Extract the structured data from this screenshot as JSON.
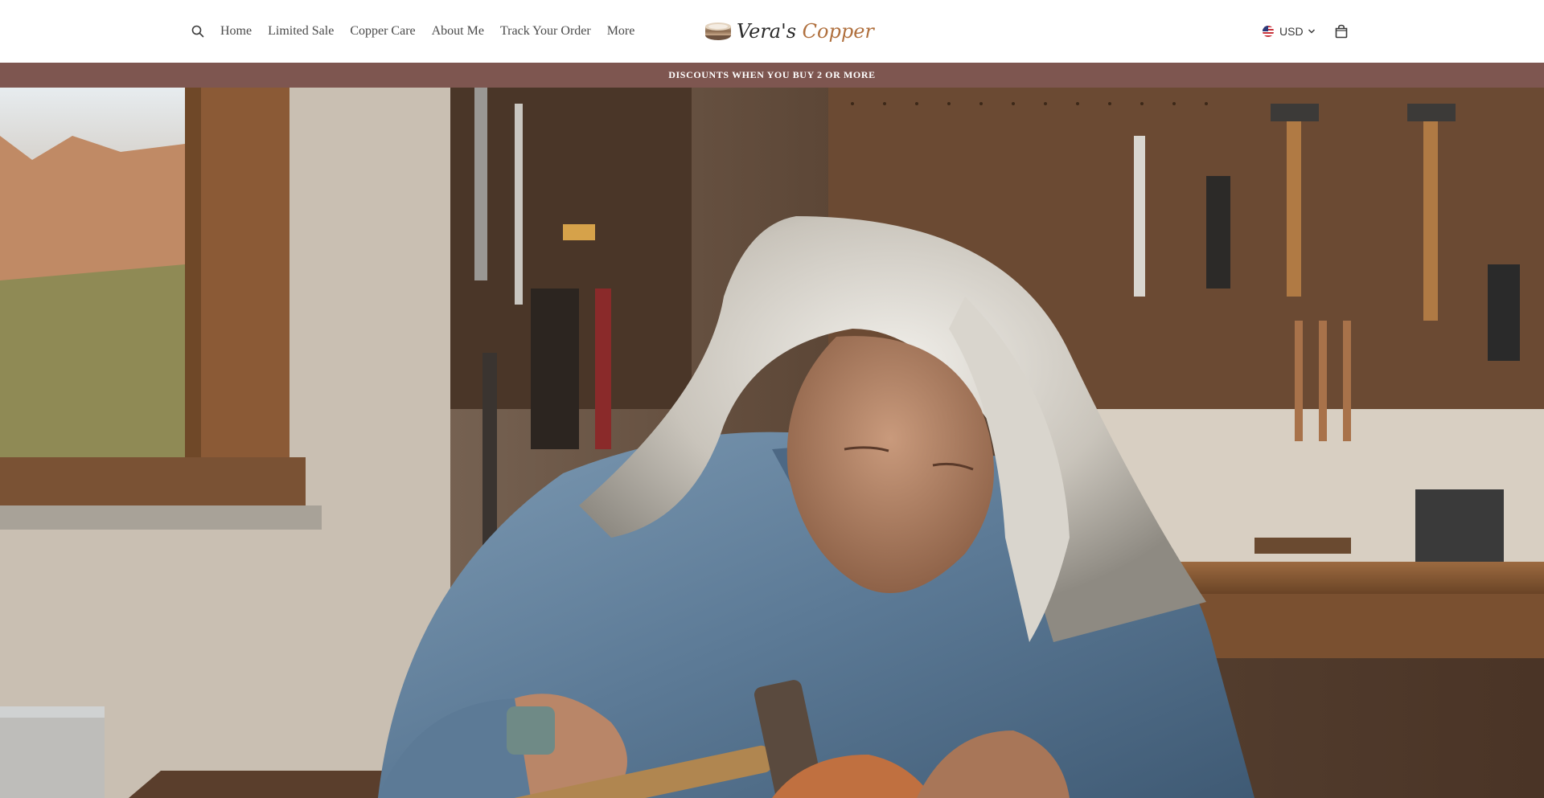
{
  "header": {
    "search_icon": "search-icon",
    "nav_items": [
      {
        "label": "Home"
      },
      {
        "label": "Limited Sale"
      },
      {
        "label": "Copper Care"
      },
      {
        "label": "About Me"
      },
      {
        "label": "Track Your Order"
      },
      {
        "label": "More"
      }
    ],
    "logo": {
      "word1": "Vera's",
      "word2": "Copper"
    },
    "currency": {
      "label": "USD",
      "flag": "us-flag-icon"
    },
    "cart_icon": "shopping-bag-icon"
  },
  "announcement": {
    "text": "DISCOUNTS WHEN YOU BUY 2 OR MORE"
  },
  "colors": {
    "announcement_bg": "#7e5650",
    "logo_accent": "#b0703e",
    "nav_text": "#4a4a4a"
  },
  "hero": {
    "image": "hero-image"
  }
}
